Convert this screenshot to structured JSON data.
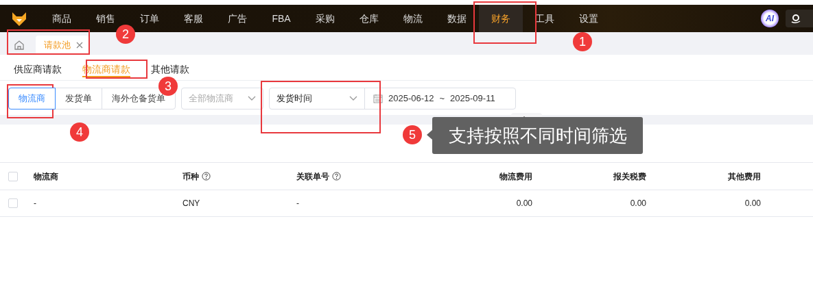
{
  "nav": {
    "items": [
      {
        "label": "商品",
        "selected": false
      },
      {
        "label": "销售",
        "selected": false
      },
      {
        "label": "订单",
        "selected": false
      },
      {
        "label": "客服",
        "selected": false
      },
      {
        "label": "广告",
        "selected": false
      },
      {
        "label": "FBA",
        "selected": false
      },
      {
        "label": "采购",
        "selected": false
      },
      {
        "label": "仓库",
        "selected": false
      },
      {
        "label": "物流",
        "selected": false
      },
      {
        "label": "数据",
        "selected": false
      },
      {
        "label": "财务",
        "selected": true
      },
      {
        "label": "工具",
        "selected": false
      },
      {
        "label": "设置",
        "selected": false
      }
    ],
    "ai_badge": "AI"
  },
  "page_tabs": [
    {
      "label": "请款池",
      "selected": true
    }
  ],
  "sub_tabs": [
    {
      "label": "供应商请款",
      "selected": false
    },
    {
      "label": "物流商请款",
      "selected": true
    },
    {
      "label": "其他请款",
      "selected": false
    }
  ],
  "filters": {
    "type_buttons": [
      {
        "label": "物流商",
        "selected": true
      },
      {
        "label": "发货单",
        "selected": false
      },
      {
        "label": "海外仓备货单",
        "selected": false
      }
    ],
    "carrier_select": {
      "placeholder": "全部物流商"
    },
    "date_type": {
      "value": "发货时间"
    },
    "date_range": {
      "start": "2025-06-12",
      "separator": "~",
      "end": "2025-09-11"
    }
  },
  "table": {
    "header_checked": false,
    "columns": [
      {
        "label": "物流商",
        "help": false,
        "kind": "text"
      },
      {
        "label": "币种",
        "help": true,
        "kind": "text"
      },
      {
        "label": "关联单号",
        "help": true,
        "kind": "text"
      },
      {
        "label": "物流费用",
        "help": false,
        "kind": "amount"
      },
      {
        "label": "报关税费",
        "help": false,
        "kind": "amount"
      },
      {
        "label": "其他费用",
        "help": false,
        "kind": "amount"
      }
    ],
    "rows": [
      {
        "checked": false,
        "cells": [
          "-",
          "CNY",
          "-",
          "0.00",
          "0.00",
          "0.00"
        ]
      }
    ]
  },
  "annotations": {
    "markers": [
      "1",
      "2",
      "3",
      "4",
      "5"
    ],
    "tooltip": "支持按照不同时间筛选"
  }
}
